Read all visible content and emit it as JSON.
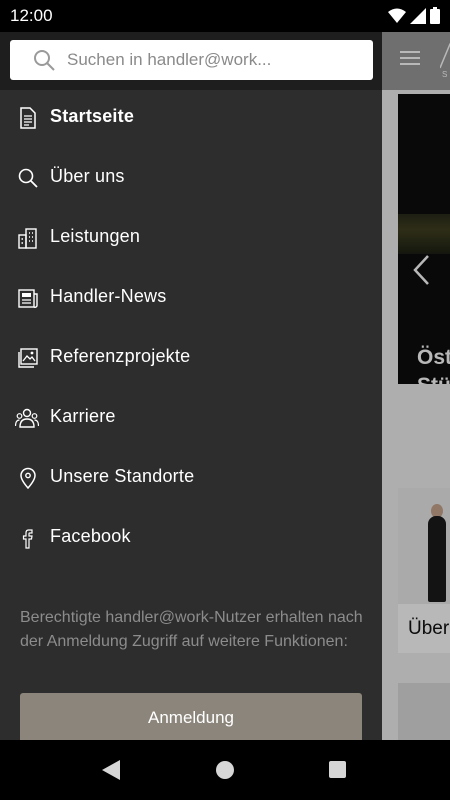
{
  "status_bar": {
    "time": "12:00",
    "icons": [
      "wifi-icon",
      "signal-icon",
      "battery-icon"
    ]
  },
  "search": {
    "placeholder": "Suchen in handler@work...",
    "value": ""
  },
  "menu": {
    "items": [
      {
        "label": "Startseite",
        "icon": "document-icon",
        "active": true
      },
      {
        "label": "Über uns",
        "icon": "search-icon",
        "active": false
      },
      {
        "label": "Leistungen",
        "icon": "buildings-icon",
        "active": false
      },
      {
        "label": "Handler-News",
        "icon": "newspaper-icon",
        "active": false
      },
      {
        "label": "Referenzprojekte",
        "icon": "image-icon",
        "active": false
      },
      {
        "label": "Karriere",
        "icon": "people-icon",
        "active": false
      },
      {
        "label": "Unsere Standorte",
        "icon": "location-pin-icon",
        "active": false
      },
      {
        "label": "Facebook",
        "icon": "facebook-icon",
        "active": false
      }
    ]
  },
  "login": {
    "info": "Berechtigte handler@work-Nutzer erhalten nach der Anmeldung Zugriff auf weitere Funktionen:",
    "button_label": "Anmeldung"
  },
  "background_app": {
    "hero_text_line1": "Öst",
    "hero_text_line2": "Stü",
    "card_label": "Über",
    "logo_text": "S"
  },
  "colors": {
    "drawer_bg": "#2d2d2d",
    "drawer_top_bg": "#1e1e1e",
    "login_button_bg": "#8c857b",
    "muted_text": "#8c8c8c",
    "app_header_bg": "#9a9a9a"
  }
}
